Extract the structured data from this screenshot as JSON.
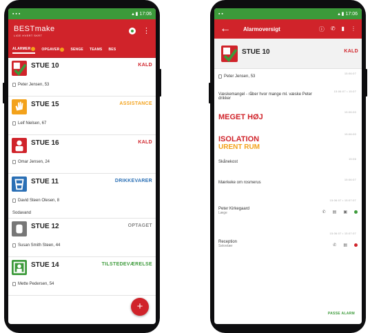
{
  "left_phone": {
    "status_bar": {
      "left": "▪ ▪ ▪",
      "right": "▴ ▮ 17:06"
    },
    "app": {
      "logo": "BESTmake",
      "logo_tagline": "LIGE HVERT SKRT"
    },
    "tabs": [
      {
        "label": "ALARMER",
        "active": true,
        "badge": true
      },
      {
        "label": "OPGAVER",
        "active": false,
        "badge": true
      },
      {
        "label": "SENGE",
        "active": false,
        "badge": false
      },
      {
        "label": "TEAMS",
        "active": false,
        "badge": false
      },
      {
        "label": "BES",
        "active": false,
        "badge": false
      }
    ],
    "alarms": [
      {
        "room": "STUE 10",
        "status": "KALD",
        "status_color": "#d0232a",
        "icon_color": "#d0232a",
        "icon": "check-badge-icon",
        "person": "Peter Jensen, 53",
        "extra": ""
      },
      {
        "room": "STUE 15",
        "status": "ASSISTANCE",
        "status_color": "#f3a21b",
        "icon_color": "#f3a21b",
        "icon": "hand-icon",
        "person": "Leif Nielsen, 67",
        "extra": ""
      },
      {
        "room": "STUE 16",
        "status": "KALD",
        "status_color": "#d0232a",
        "icon_color": "#d0232a",
        "icon": "person-icon",
        "person": "Omar Jensen, 24",
        "extra": ""
      },
      {
        "room": "STUE 11",
        "status": "DRIKKEVARER",
        "status_color": "#2a6fb5",
        "icon_color": "#2a6fb5",
        "icon": "cup-icon",
        "person": "David Steen Olesen, 8",
        "extra": "Sodavand"
      },
      {
        "room": "STUE 12",
        "status": "OPTAGET",
        "status_color": "#888888",
        "icon_color": "#777777",
        "icon": "occupied-icon",
        "person": "Susan Smith Steen, 44",
        "extra": ""
      },
      {
        "room": "STUE 14",
        "status": "TILSTEDEVÆRELSE",
        "status_color": "#3c9a3a",
        "icon_color": "#3c9a3a",
        "icon": "person-present-icon",
        "person": "Mette Pedersen, 54",
        "extra": ""
      }
    ],
    "fab_label": "+"
  },
  "right_phone": {
    "status_bar": {
      "left": "▪ ▪",
      "right": "▴ ▮ 17:06"
    },
    "toolbar": {
      "back": "←",
      "title": "Alarmoversigt"
    },
    "header": {
      "room": "STUE 10",
      "status": "KALD"
    },
    "rows": [
      {
        "kind": "person",
        "text": "Peter Jensen, 53",
        "time": "15:06:07"
      },
      {
        "kind": "text",
        "text": "Væskemangel - råber hvor mange ml. væske Peter drikker",
        "time": "15:06:07 • 15:07"
      },
      {
        "kind": "red",
        "text": "MEGET HØJ",
        "time": "15:06:00"
      },
      {
        "kind": "isolation",
        "text": "ISOLATION",
        "text2": "URENT RUM",
        "time": "15:06:00"
      },
      {
        "kind": "text",
        "text": "Skånekost",
        "time": "15:06"
      },
      {
        "kind": "text",
        "text": "Mærkeke om rosmerus",
        "time": "15:06:07"
      }
    ],
    "contacts": [
      {
        "name": "Peter Kirkegaard",
        "role": "Læge",
        "time": "15:06:07 • 15:07:07",
        "dot": "#3c9a3a",
        "icons": [
          "phone-icon",
          "message-icon",
          "monitor-icon"
        ]
      },
      {
        "name": "Reception",
        "role": "Sekretær",
        "time": "15:06:07 • 15:07:07",
        "dot": "#d0232a",
        "icons": [
          "phone-icon",
          "message-icon"
        ]
      }
    ],
    "accept_label": "PASSE ALARM"
  }
}
